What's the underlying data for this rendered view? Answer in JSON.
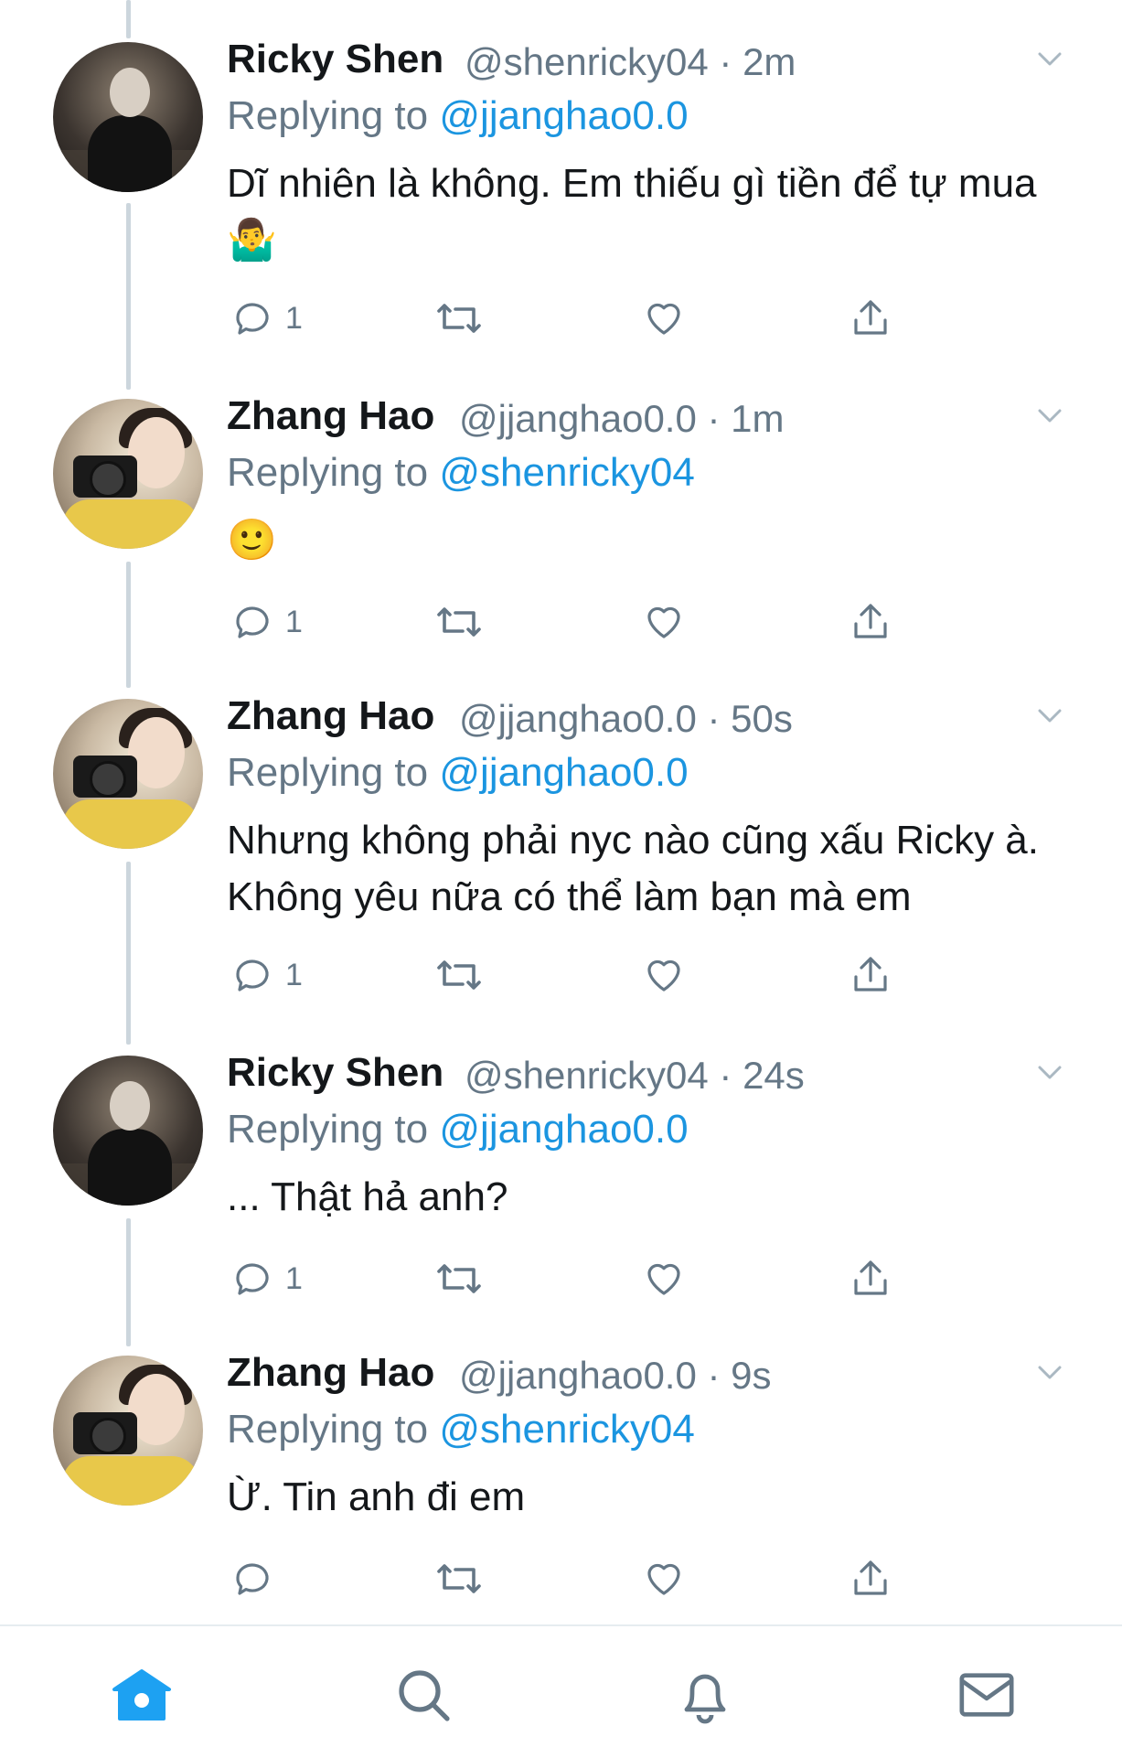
{
  "tweets": [
    {
      "avatar": "ricky",
      "name": "Ricky Shen",
      "handle": "@shenricky04",
      "time": "2m",
      "reply_prefix": "Replying to",
      "reply_to": "@jjanghao0.0",
      "text": "Dĩ nhiên là không. Em thiếu gì tiền để tự mua 🤷‍♂️",
      "reply_count": "1"
    },
    {
      "avatar": "zhang",
      "name": "Zhang Hao",
      "handle": "@jjanghao0.0",
      "time": "1m",
      "reply_prefix": "Replying to",
      "reply_to": "@shenricky04",
      "text": "🙂",
      "reply_count": "1"
    },
    {
      "avatar": "zhang",
      "name": "Zhang Hao",
      "handle": "@jjanghao0.0",
      "time": "50s",
      "reply_prefix": "Replying to",
      "reply_to": "@jjanghao0.0",
      "text": "Nhưng không phải nyc nào cũng xấu Ricky à. Không yêu nữa có thể làm bạn mà em",
      "reply_count": "1"
    },
    {
      "avatar": "ricky",
      "name": "Ricky Shen",
      "handle": "@shenricky04",
      "time": "24s",
      "reply_prefix": "Replying to",
      "reply_to": "@jjanghao0.0",
      "text": "... Thật hả anh?",
      "reply_count": "1"
    },
    {
      "avatar": "zhang",
      "name": "Zhang Hao",
      "handle": "@jjanghao0.0",
      "time": "9s",
      "reply_prefix": "Replying to",
      "reply_to": "@shenricky04",
      "text": "Ừ. Tin anh đi em",
      "reply_count": ""
    }
  ],
  "tabbar": {
    "items": [
      "home-icon",
      "search-icon",
      "bell-icon",
      "mail-icon"
    ],
    "active": "home-icon"
  },
  "colors": {
    "accent": "#1da1f2",
    "link": "#1b95e0",
    "muted": "#657786",
    "thread": "#ccd6dd"
  }
}
